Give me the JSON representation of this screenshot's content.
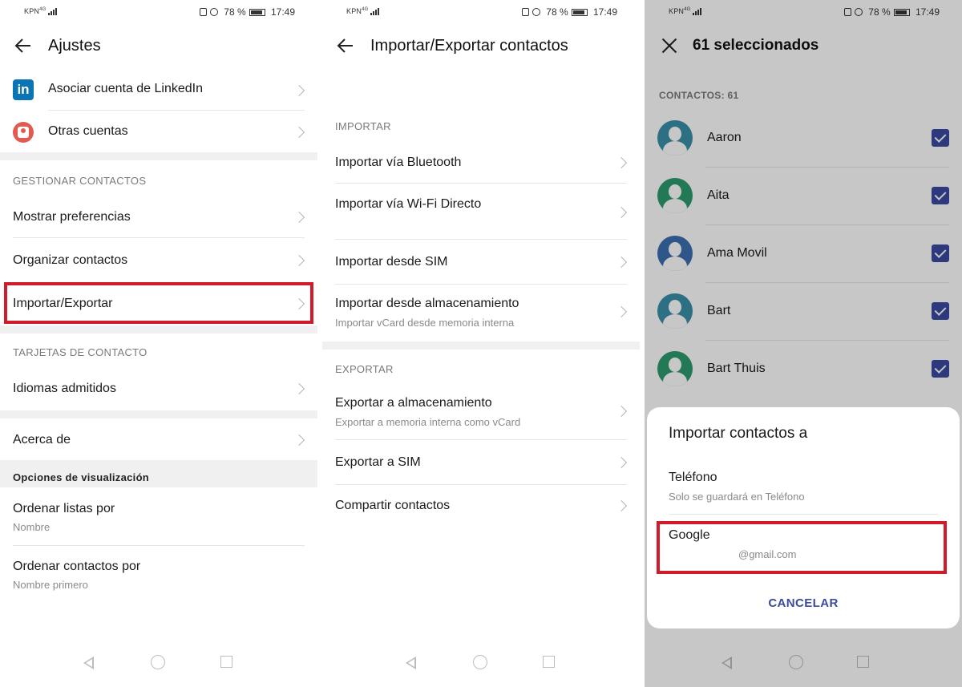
{
  "status_bar": {
    "carrier": "KPN",
    "network": "4G",
    "battery": "78 %",
    "time": "17:49"
  },
  "screen1": {
    "title": "Ajustes",
    "accounts": [
      {
        "label": "Asociar cuenta de LinkedIn",
        "icon": "linkedin-icon"
      },
      {
        "label": "Otras cuentas",
        "icon": "account-icon"
      }
    ],
    "linkedin_glyph": "in",
    "section_manage": "GESTIONAR CONTACTOS",
    "manage_items": [
      "Mostrar preferencias",
      "Organizar contactos",
      "Importar/Exportar"
    ],
    "section_cards": "TARJETAS DE CONTACTO",
    "cards_items": [
      "Idiomas admitidos"
    ],
    "about": "Acerca de",
    "section_display": "Opciones de visualización",
    "display_items": [
      {
        "label": "Ordenar listas por",
        "value": "Nombre"
      },
      {
        "label": "Ordenar contactos por",
        "value": "Nombre primero"
      }
    ]
  },
  "screen2": {
    "title": "Importar/Exportar contactos",
    "section_import": "IMPORTAR",
    "import_items": [
      {
        "label": "Importar vía Bluetooth",
        "sub": ""
      },
      {
        "label": "Importar vía Wi-Fi Directo",
        "sub": ""
      },
      {
        "label": "Importar desde SIM",
        "sub": ""
      },
      {
        "label": "Importar desde almacenamiento",
        "sub": "Importar vCard desde memoria interna"
      }
    ],
    "section_export": "EXPORTAR",
    "export_items": [
      {
        "label": "Exportar a almacenamiento",
        "sub": "Exportar a memoria interna como vCard"
      },
      {
        "label": "Exportar a SIM",
        "sub": ""
      },
      {
        "label": "Compartir contactos",
        "sub": ""
      }
    ]
  },
  "screen3": {
    "title": "61 seleccionados",
    "contacts_header": "CONTACTOS: 61",
    "contacts": [
      {
        "name": "Aaron",
        "color": "#3a8fa8",
        "checked": true
      },
      {
        "name": "Aita",
        "color": "#2e9a6e",
        "checked": true
      },
      {
        "name": "Ama Movil",
        "color": "#3c6fb0",
        "checked": true
      },
      {
        "name": "Bart",
        "color": "#3a8fa8",
        "checked": true
      },
      {
        "name": "Bart Thuis",
        "color": "#2e9a6e",
        "checked": true
      }
    ],
    "dialog": {
      "title": "Importar contactos a",
      "option1_label": "Teléfono",
      "option1_sub": "Solo se guardará en Teléfono",
      "option2_label": "Google",
      "option2_sub": "@gmail.com",
      "cancel": "CANCELAR"
    }
  },
  "colors": {
    "highlight": "#d21b2a",
    "checkbox": "#3c4aa0",
    "accent_text": "#3c4aa0"
  }
}
